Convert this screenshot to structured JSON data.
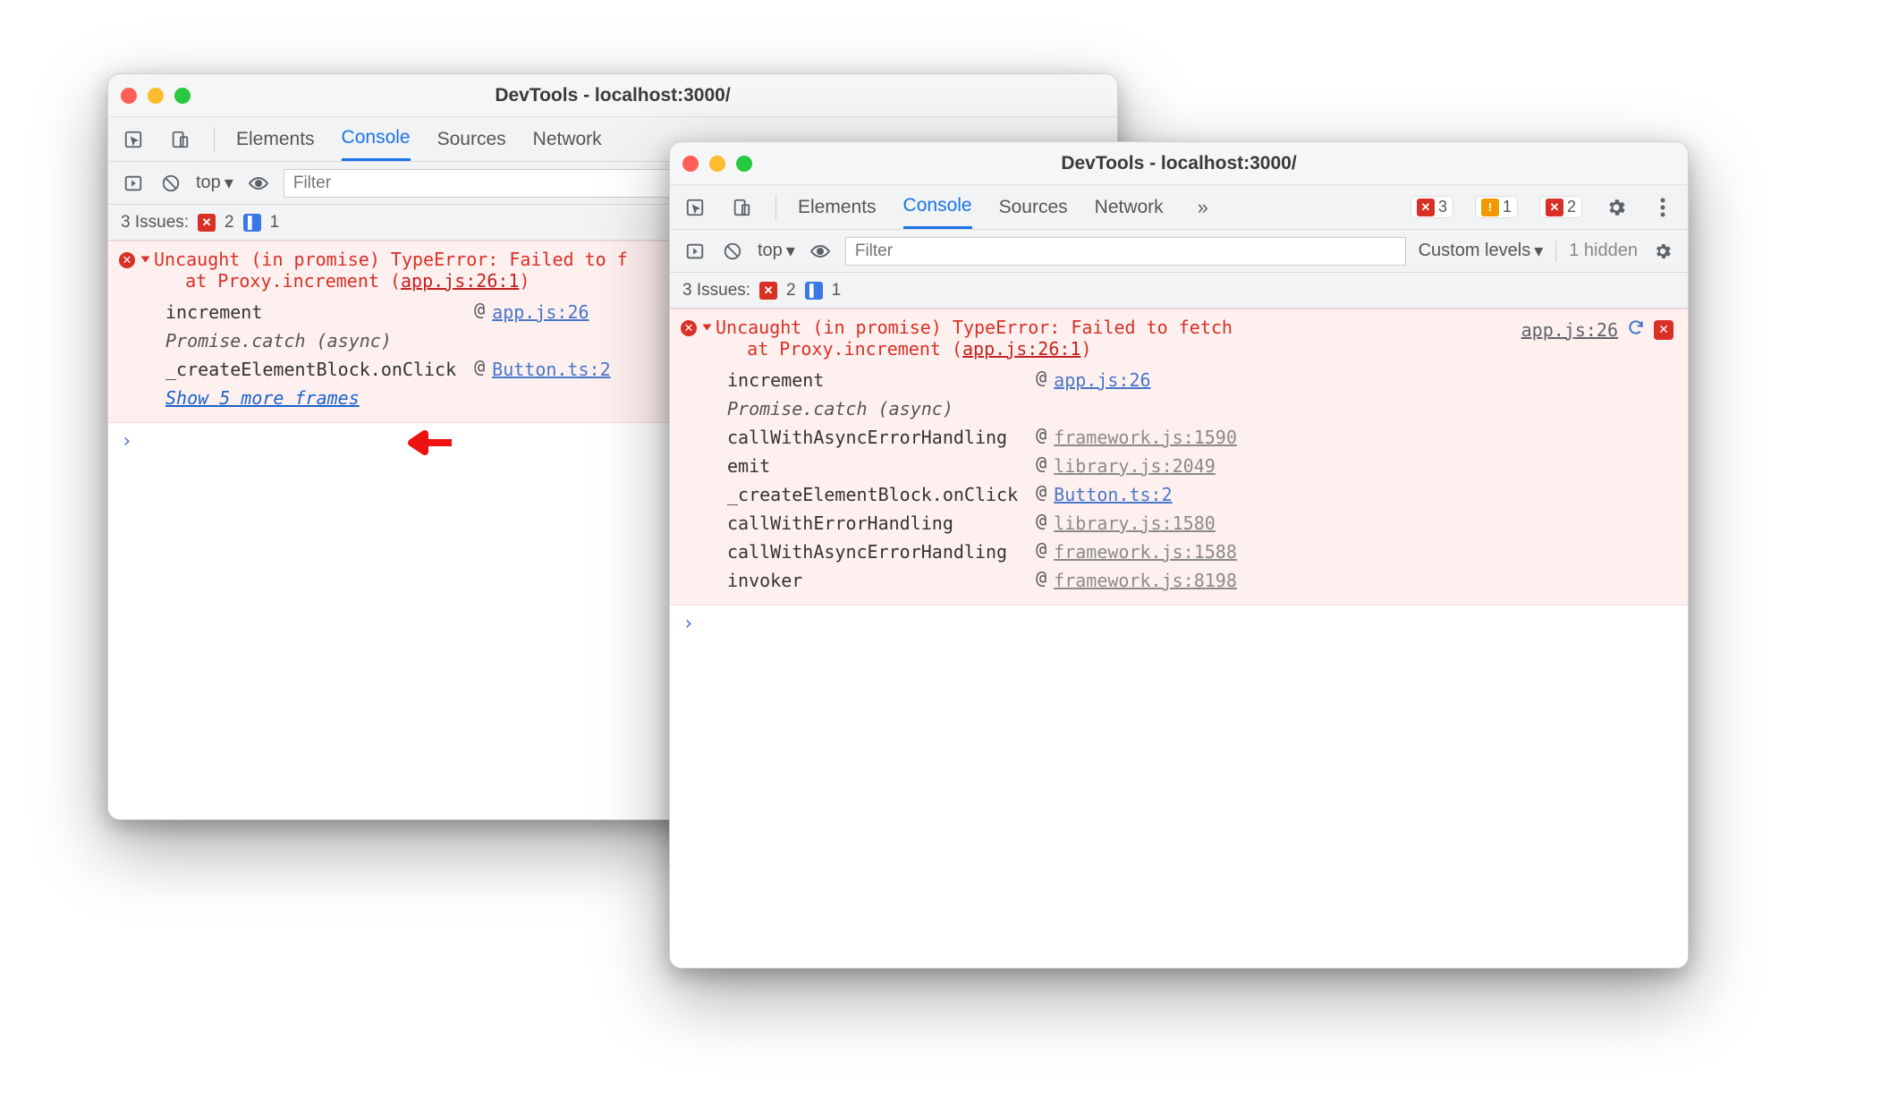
{
  "windowA": {
    "title": "DevTools - localhost:3000/",
    "tabs": [
      "Elements",
      "Console",
      "Sources",
      "Network"
    ],
    "active_tab": "Console",
    "toolbar": {
      "context": "top",
      "filter_placeholder": "Filter"
    },
    "issues": {
      "label": "3 Issues:",
      "err": "2",
      "msg": "1"
    },
    "error": {
      "line1": "Uncaught (in promise) TypeError: Failed to f",
      "line2_prefix": "    at Proxy.increment (",
      "line2_src": "app.js:26:1",
      "line2_suffix": ")",
      "stack": [
        {
          "fn": "increment",
          "at": "@",
          "src": "app.js:26",
          "grey": false
        },
        {
          "fn": "Promise.catch (async)",
          "italic": true
        },
        {
          "fn": "_createElementBlock.onClick",
          "at": "@",
          "src": "Button.ts:2",
          "grey": false
        }
      ],
      "show_more": "Show 5 more frames"
    }
  },
  "windowB": {
    "title": "DevTools - localhost:3000/",
    "tabs": [
      "Elements",
      "Console",
      "Sources",
      "Network"
    ],
    "active_tab": "Console",
    "badges": {
      "err": "3",
      "warn": "1",
      "msg": "2"
    },
    "toolbar": {
      "context": "top",
      "filter_placeholder": "Filter",
      "levels": "Custom levels",
      "hidden": "1 hidden"
    },
    "issues": {
      "label": "3 Issues:",
      "err": "2",
      "msg": "1"
    },
    "error": {
      "line1": "Uncaught (in promise) TypeError: Failed to fetch",
      "line2_prefix": "    at Proxy.increment (",
      "line2_src": "app.js:26:1",
      "line2_suffix": ")",
      "right_src": "app.js:26",
      "stack": [
        {
          "fn": "increment",
          "at": "@",
          "src": "app.js:26",
          "grey": false
        },
        {
          "fn": "Promise.catch (async)",
          "italic": true
        },
        {
          "fn": "callWithAsyncErrorHandling",
          "at": "@",
          "src": "framework.js:1590",
          "grey": true
        },
        {
          "fn": "emit",
          "at": "@",
          "src": "library.js:2049",
          "grey": true
        },
        {
          "fn": "_createElementBlock.onClick",
          "at": "@",
          "src": "Button.ts:2",
          "grey": false
        },
        {
          "fn": "callWithErrorHandling",
          "at": "@",
          "src": "library.js:1580",
          "grey": true
        },
        {
          "fn": "callWithAsyncErrorHandling",
          "at": "@",
          "src": "framework.js:1588",
          "grey": true
        },
        {
          "fn": "invoker",
          "at": "@",
          "src": "framework.js:8198",
          "grey": true
        }
      ]
    }
  }
}
